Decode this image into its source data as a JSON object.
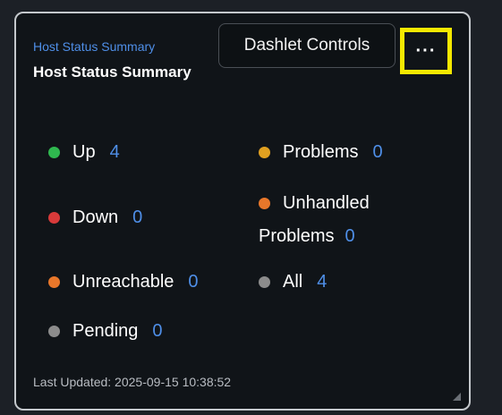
{
  "dashlet": {
    "subtitle": "Host Status Summary",
    "title": "Host Status Summary",
    "controls_tooltip": "Dashlet Controls",
    "menu_label": "···",
    "last_updated": "Last Updated: 2025-09-15 10:38:52"
  },
  "statuses": {
    "up": {
      "label": "Up",
      "count": "4",
      "color": "#2fb84f"
    },
    "problems": {
      "label": "Problems",
      "count": "0",
      "color": "#e0a020"
    },
    "down": {
      "label": "Down",
      "count": "0",
      "color": "#d83a3a"
    },
    "unhandled": {
      "label_line1": "Unhandled",
      "label_line2": "Problems",
      "count": "0",
      "color": "#e8772a"
    },
    "unreachable": {
      "label": "Unreachable",
      "count": "0",
      "color": "#e8772a"
    },
    "all": {
      "label": "All",
      "count": "4",
      "color": "#8c8c8c"
    },
    "pending": {
      "label": "Pending",
      "count": "0",
      "color": "#8c8c8c"
    }
  },
  "colors": {
    "link": "#4f8fe8",
    "highlight_border": "#f5e800",
    "panel_bg": "#101418"
  },
  "icons": {
    "menu": "more-horizontal-icon",
    "resize": "resize-grip-icon"
  }
}
